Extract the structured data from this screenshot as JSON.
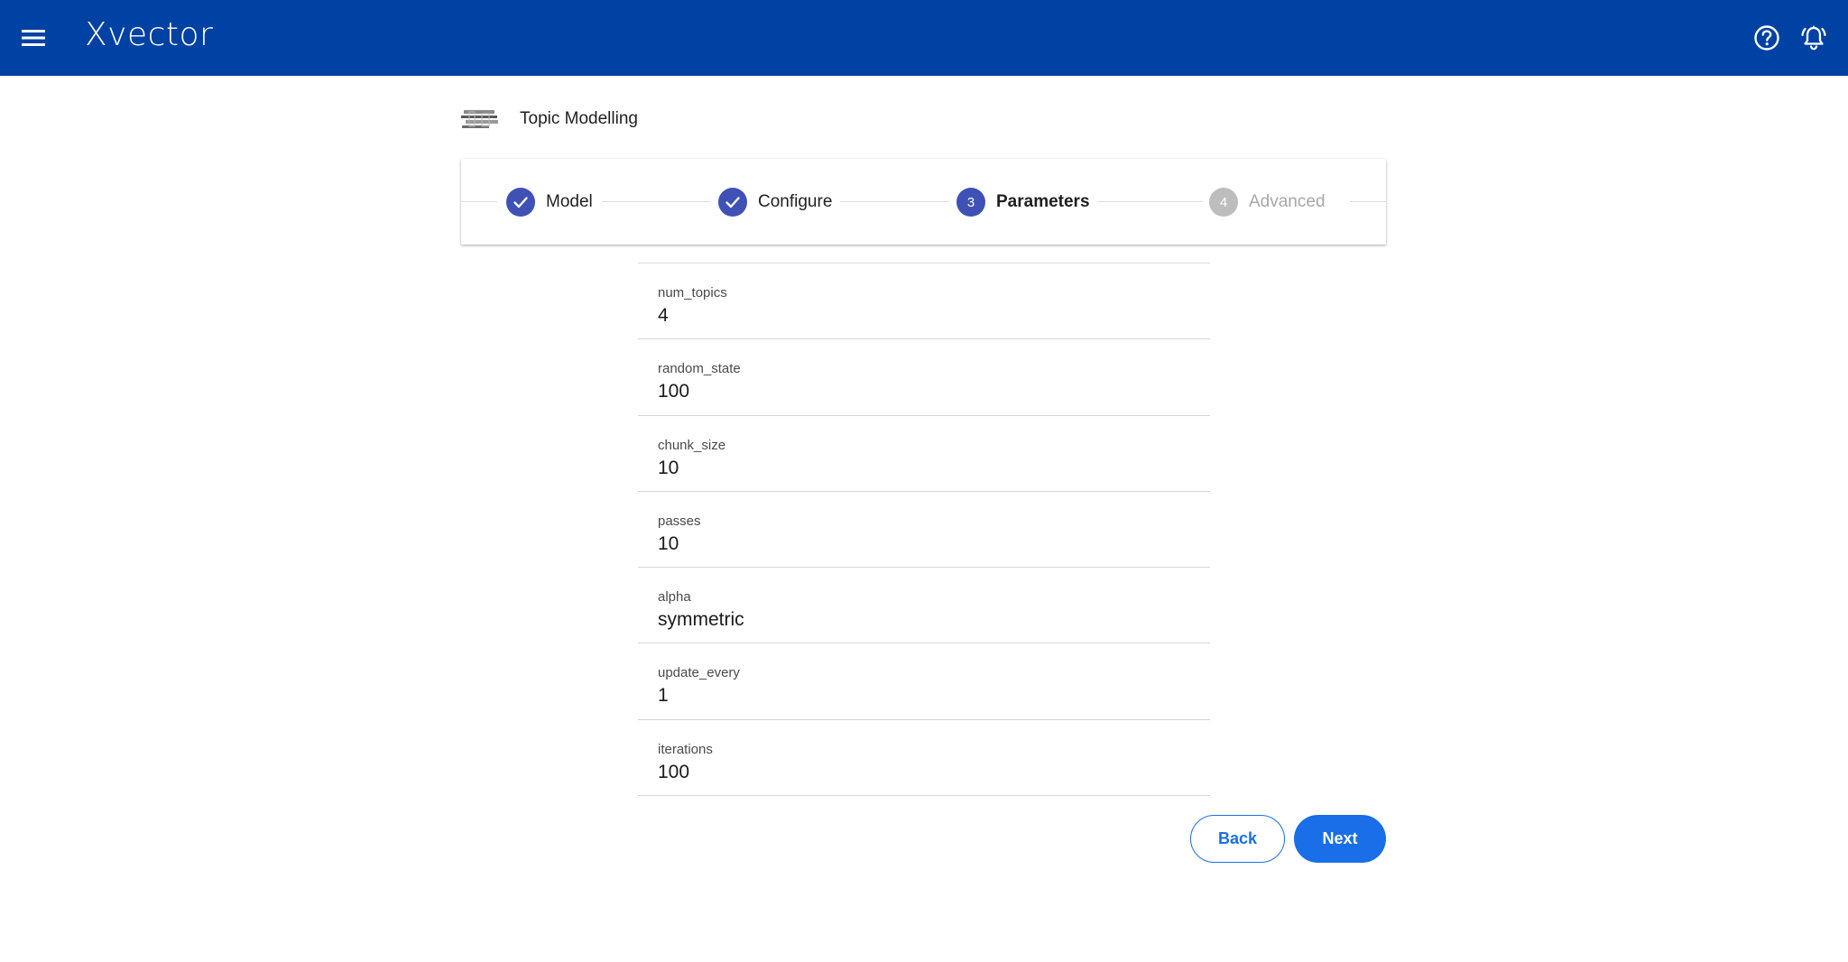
{
  "header": {
    "brand": "Xvector",
    "menu_icon": "hamburger-menu-icon",
    "help_icon": "help-circle-icon",
    "notifications_icon": "bell-icon",
    "background_color": "#0041a4"
  },
  "page": {
    "title": "Topic Modelling",
    "logo_icon": "topic-modelling-logo-icon"
  },
  "stepper": {
    "steps": [
      {
        "label": "Model",
        "state": "completed",
        "number": "1"
      },
      {
        "label": "Configure",
        "state": "completed",
        "number": "2"
      },
      {
        "label": "Parameters",
        "state": "active",
        "number": "3"
      },
      {
        "label": "Advanced",
        "state": "inactive",
        "number": "4"
      }
    ],
    "active_color": "#3f51b5",
    "inactive_color": "#bdbdbd"
  },
  "parameters": [
    {
      "label": "num_topics",
      "value": "4"
    },
    {
      "label": "random_state",
      "value": "100"
    },
    {
      "label": "chunk_size",
      "value": "10"
    },
    {
      "label": "passes",
      "value": "10"
    },
    {
      "label": "alpha",
      "value": "symmetric"
    },
    {
      "label": "update_every",
      "value": "1"
    },
    {
      "label": "iterations",
      "value": "100"
    }
  ],
  "actions": {
    "back_label": "Back",
    "next_label": "Next",
    "primary_color": "#1a6ee8"
  }
}
